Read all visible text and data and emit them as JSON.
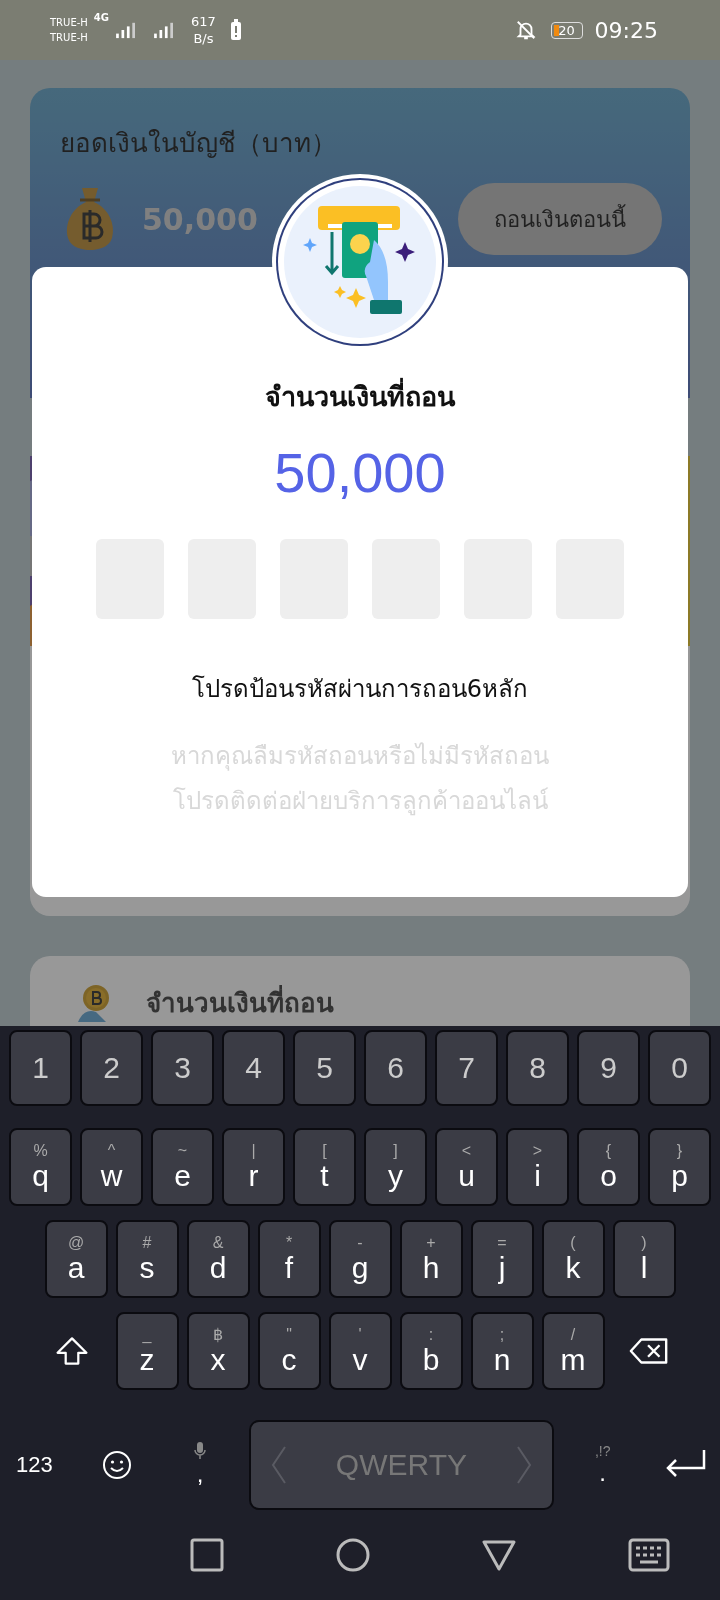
{
  "status_bar": {
    "carrier_1": "TRUE-H",
    "carrier_2": "TRUE-H",
    "network": "4G",
    "speed": "617",
    "speed_unit": "B/s",
    "battery": "20",
    "time": "09:25"
  },
  "balance_card": {
    "title": "ยอดเงินในบัญชี（บาท）",
    "amount": "50,000",
    "button": "ถอนเงินตอนนี้"
  },
  "withdraw_card": {
    "title": "จำนวนเงินที่ถอน"
  },
  "dialog": {
    "title": "จำนวนเงินที่ถอน",
    "amount": "50,000",
    "pin_boxes": [
      {
        "filled": false
      },
      {
        "filled": false
      },
      {
        "filled": false
      },
      {
        "filled": false
      },
      {
        "filled": false
      },
      {
        "filled": false
      }
    ],
    "prompt": "โปรดป้อนรหัสผ่านการถอน6หลัก",
    "help_lines": [
      "หากคุณลืมรหัสถอนหรือไม่มีรหัสถอน",
      "โปรดติดต่อฝ่ายบริการลูกค้าออนไลน์"
    ]
  },
  "keyboard": {
    "number_row": [
      "1",
      "2",
      "3",
      "4",
      "5",
      "6",
      "7",
      "8",
      "9",
      "0"
    ],
    "letter_rows": [
      [
        {
          "label": "q",
          "alt": "%"
        },
        {
          "label": "w",
          "alt": "^"
        },
        {
          "label": "e",
          "alt": "~"
        },
        {
          "label": "r",
          "alt": "|"
        },
        {
          "label": "t",
          "alt": "["
        },
        {
          "label": "y",
          "alt": "]"
        },
        {
          "label": "u",
          "alt": "<"
        },
        {
          "label": "i",
          "alt": ">"
        },
        {
          "label": "o",
          "alt": "{"
        },
        {
          "label": "p",
          "alt": "}"
        }
      ],
      [
        {
          "label": "a",
          "alt": "@"
        },
        {
          "label": "s",
          "alt": "#"
        },
        {
          "label": "d",
          "alt": "&"
        },
        {
          "label": "f",
          "alt": "*"
        },
        {
          "label": "g",
          "alt": "-"
        },
        {
          "label": "h",
          "alt": "+"
        },
        {
          "label": "j",
          "alt": "="
        },
        {
          "label": "k",
          "alt": "("
        },
        {
          "label": "l",
          "alt": ")"
        }
      ],
      [
        {
          "label": "z",
          "alt": "_"
        },
        {
          "label": "x",
          "alt": "฿"
        },
        {
          "label": "c",
          "alt": "\""
        },
        {
          "label": "v",
          "alt": "'"
        },
        {
          "label": "b",
          "alt": ":"
        },
        {
          "label": "n",
          "alt": ";"
        },
        {
          "label": "m",
          "alt": "/"
        }
      ]
    ],
    "mode_key": "123",
    "comma": ",",
    "space": "QWERTY",
    "period": ".",
    "period_alt": ",!?"
  }
}
